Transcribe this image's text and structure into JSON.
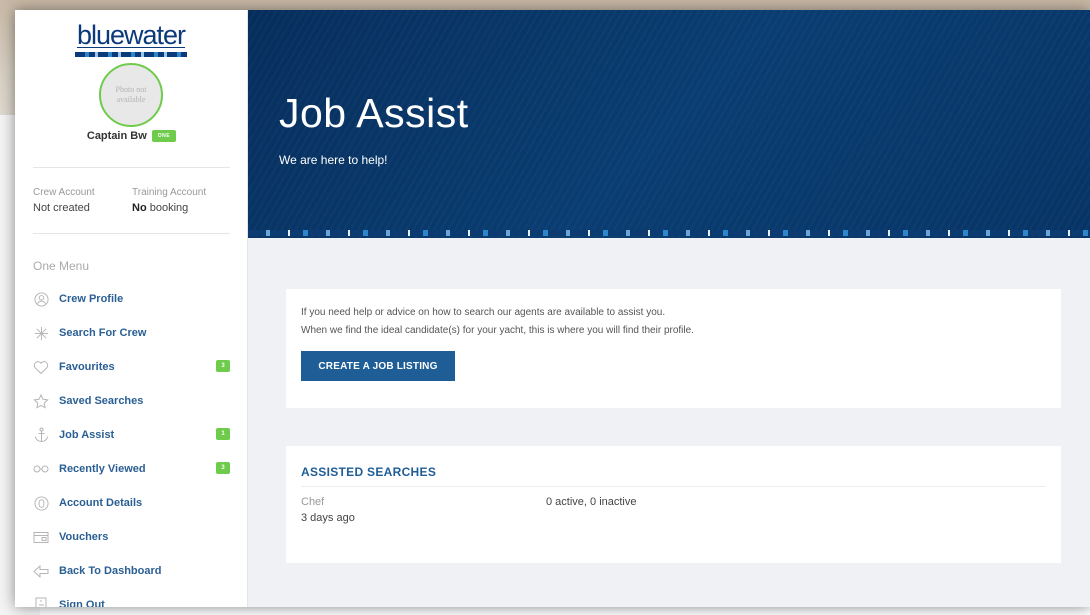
{
  "brand": {
    "logo_text": "bluewater"
  },
  "user": {
    "avatar_text": "Photo not available",
    "name": "Captain Bw",
    "badge": "ONE",
    "crew_account_label": "Crew Account",
    "crew_account_value": "Not created",
    "training_account_label": "Training Account",
    "training_account_bold": "No",
    "training_account_value": " booking"
  },
  "menu": {
    "heading": "One Menu",
    "items": [
      {
        "label": "Crew Profile",
        "icon": "person-circle-icon"
      },
      {
        "label": "Search For Crew",
        "icon": "snowflake-icon"
      },
      {
        "label": "Favourites",
        "icon": "heart-icon",
        "count": "3"
      },
      {
        "label": "Saved Searches",
        "icon": "star-icon"
      },
      {
        "label": "Job Assist",
        "icon": "anchor-icon",
        "count": "1"
      },
      {
        "label": "Recently Viewed",
        "icon": "glasses-icon",
        "count": "3"
      },
      {
        "label": "Account Details",
        "icon": "account-icon"
      },
      {
        "label": "Vouchers",
        "icon": "voucher-icon"
      },
      {
        "label": "Back To Dashboard",
        "icon": "back-icon"
      },
      {
        "label": "Sign Out",
        "icon": "sign-out-icon"
      }
    ]
  },
  "hero": {
    "title": "Job Assist",
    "subtitle": "We are here to help!"
  },
  "help_card": {
    "line1": "If you need help or advice on how to search our agents are available to assist you.",
    "line2": "When we find the ideal candidate(s) for your yacht, this is where you will find their profile.",
    "button": "CREATE A JOB LISTING"
  },
  "assisted": {
    "heading": "ASSISTED SEARCHES",
    "rows": [
      {
        "role": "Chef",
        "time": "3 days ago",
        "status": "0 active, 0 inactive"
      }
    ]
  },
  "colors": {
    "accent": "#1f5d97",
    "badge_green": "#6ecb4c",
    "hero_bg": "#0a3d72"
  }
}
